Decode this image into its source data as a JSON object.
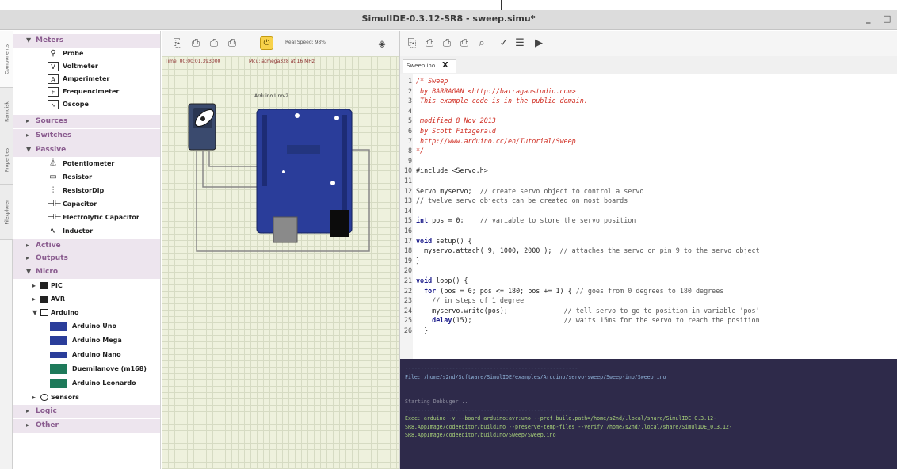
{
  "window": {
    "title": "SimulIDE-0.3.12-SR8 - sweep.simu*",
    "minimize": "_",
    "maximize": "□"
  },
  "side_tabs": [
    "Components",
    "Ramdisk",
    "Properties",
    "Filexplorer"
  ],
  "tree": {
    "categories": {
      "meters": "Meters",
      "sources": "Sources",
      "switches": "Switches",
      "passive": "Passive",
      "active": "Active",
      "outputs": "Outputs",
      "micro": "Micro",
      "logic": "Logic",
      "other": "Other"
    },
    "meters": [
      "Probe",
      "Voltmeter",
      "Amperimeter",
      "Frequencimeter",
      "Oscope"
    ],
    "passive": [
      "Potentiometer",
      "Resistor",
      "ResistorDip",
      "Capacitor",
      "Electrolytic Capacitor",
      "Inductor"
    ],
    "micro_groups": [
      "PIC",
      "AVR",
      "Arduino"
    ],
    "arduino_boards": [
      "Arduino Uno",
      "Arduino Mega",
      "Arduino Nano",
      "Duemilanove (m168)",
      "Arduino Leonardo"
    ],
    "sensors": "Sensors"
  },
  "circuit": {
    "speed_label": "Real Speed: 98%",
    "status_time": "Time: 00:00:01.393000",
    "status_mcu": "Mcu: atmega328 at 16 MHz",
    "board_label": "Arduino Uno-2"
  },
  "editor": {
    "tab_label": "Sweep.ino",
    "tab_close": "X",
    "lines": [
      "/* Sweep",
      " by BARRAGAN <http://barraganstudio.com>",
      " This example code is in the public domain.",
      "",
      " modified 8 Nov 2013",
      " by Scott Fitzgerald",
      " http://www.arduino.cc/en/Tutorial/Sweep",
      "*/",
      "",
      "#include <Servo.h>",
      "",
      "Servo myservo;  // create servo object to control a servo",
      "// twelve servo objects can be created on most boards",
      "",
      "int pos = 0;    // variable to store the servo position",
      "",
      "void setup() {",
      "  myservo.attach( 9, 1000, 2000 );  // attaches the servo on pin 9 to the servo object",
      "}",
      "",
      "void loop() {",
      "  for (pos = 0; pos <= 180; pos += 1) { // goes from 0 degrees to 180 degrees",
      "    // in steps of 1 degree",
      "    myservo.write(pos);              // tell servo to go to position in variable 'pos'",
      "    delay(15);                       // waits 15ms for the servo to reach the position",
      "  }"
    ]
  },
  "console": {
    "lines": [
      "-------------------------------------------------------",
      "File: /home/s2nd/Software/SimulIDE/examples/Arduino/servo-sweep/Sweep-ino/Sweep.ino",
      "",
      "",
      "Starting Debbuger...",
      "-------------------------------------------------------",
      "Exec: arduino -v --board arduino:avr:uno --pref build.path=/home/s2nd/.local/share/SimulIDE_0.3.12-",
      "SR8.AppImage/codeeditor/buildIno --preserve-temp-files --verify /home/s2nd/.local/share/SimulIDE_0.3.12-",
      "SR8.AppImage/codeeditor/buildIno/Sweep/Sweep.ino"
    ]
  },
  "colors": {
    "category_bg": "#ede5ee",
    "category_text": "#8a5c8f",
    "circuit_bg": "#eef1dd",
    "console_bg": "#2e2a4a",
    "comment": "#cf2a1f",
    "board_blue": "#2a3d9a"
  }
}
